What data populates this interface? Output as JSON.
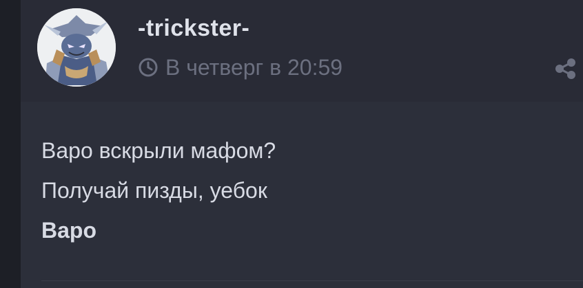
{
  "post": {
    "author": "-trickster-",
    "timestamp": "В четверг в 20:59",
    "lines": [
      "Варо вскрыли мафом?",
      "Получай пизды, уебок",
      "Варо"
    ]
  },
  "icons": {
    "clock": "clock-icon",
    "share": "share-icon",
    "avatar": "avatar-image"
  },
  "colors": {
    "page_background": "#1d1f26",
    "header_background": "#292b36",
    "body_background": "#2c2f3a",
    "text": "#d8dbe4",
    "muted_text": "#6c7080"
  }
}
